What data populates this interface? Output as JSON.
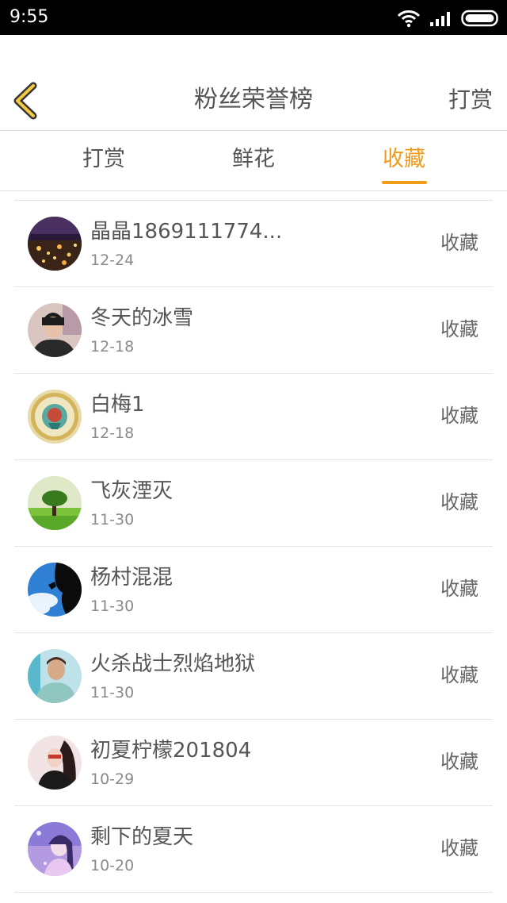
{
  "status_bar": {
    "time": "9:55",
    "icons": [
      "wifi-icon",
      "signal-icon",
      "battery-icon"
    ]
  },
  "header": {
    "back_icon": "chevron-left-icon",
    "title": "粉丝荣誉榜",
    "right_action": "打赏"
  },
  "tabs": [
    {
      "label": "打赏",
      "active": false
    },
    {
      "label": "鲜花",
      "active": false
    },
    {
      "label": "收藏",
      "active": true
    }
  ],
  "list": {
    "items": [
      {
        "name": "晶晶1869111774...",
        "date": "12-24",
        "action": "收藏"
      },
      {
        "name": "冬天的冰雪",
        "date": "12-18",
        "action": "收藏"
      },
      {
        "name": "白梅1",
        "date": "12-18",
        "action": "收藏"
      },
      {
        "name": "飞灰湮灭",
        "date": "11-30",
        "action": "收藏"
      },
      {
        "name": "杨村混混",
        "date": "11-30",
        "action": "收藏"
      },
      {
        "name": "火杀战士烈焰地狱",
        "date": "11-30",
        "action": "收藏"
      },
      {
        "name": "初夏柠檬201804",
        "date": "10-29",
        "action": "收藏"
      },
      {
        "name": "剩下的夏天",
        "date": "10-20",
        "action": "收藏"
      }
    ]
  },
  "colors": {
    "accent": "#f29a19",
    "text": "#555555",
    "subtext": "#8a8a8a",
    "divider": "#e6e6e6"
  }
}
